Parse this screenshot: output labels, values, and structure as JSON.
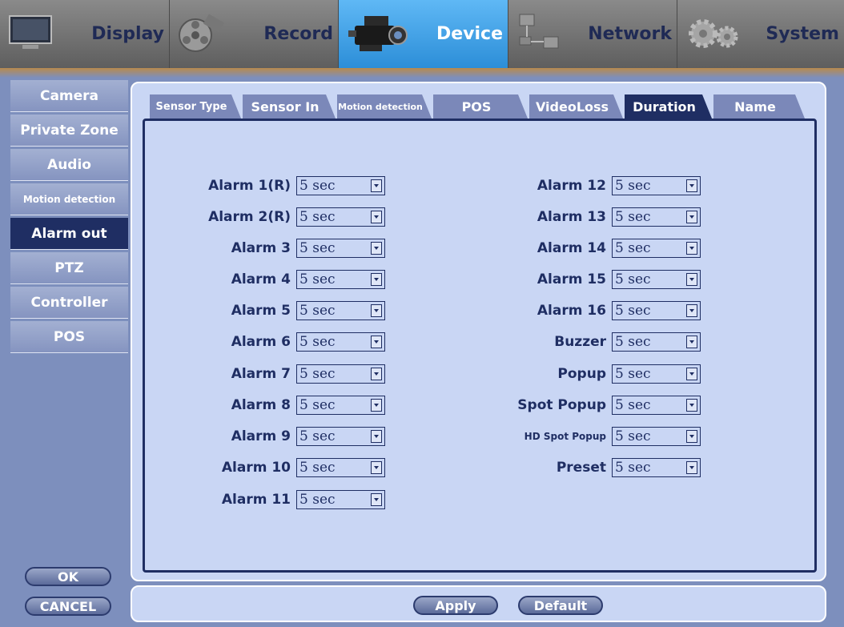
{
  "top_tabs": [
    {
      "label": "Display",
      "icon": "monitor-icon",
      "active": false
    },
    {
      "label": "Record",
      "icon": "film-reel-icon",
      "active": false
    },
    {
      "label": "Device",
      "icon": "video-camera-icon",
      "active": true
    },
    {
      "label": "Network",
      "icon": "network-icon",
      "active": false
    },
    {
      "label": "System",
      "icon": "gears-icon",
      "active": false
    }
  ],
  "sidebar": {
    "items": [
      {
        "label": "Camera"
      },
      {
        "label": "Private Zone"
      },
      {
        "label": "Audio"
      },
      {
        "label": "Motion detection"
      },
      {
        "label": "Alarm out",
        "active": true
      },
      {
        "label": "PTZ"
      },
      {
        "label": "Controller"
      },
      {
        "label": "POS"
      }
    ],
    "ok_label": "OK",
    "cancel_label": "CANCEL"
  },
  "sub_tabs": [
    {
      "label": "Sensor Type"
    },
    {
      "label": "Sensor In"
    },
    {
      "label": "Motion detection"
    },
    {
      "label": "POS"
    },
    {
      "label": "VideoLoss"
    },
    {
      "label": "Duration",
      "active": true
    },
    {
      "label": "Name"
    }
  ],
  "left_alarms": [
    {
      "label": "Alarm 1(R)",
      "value": "5 sec"
    },
    {
      "label": "Alarm 2(R)",
      "value": "5 sec"
    },
    {
      "label": "Alarm 3",
      "value": "5 sec"
    },
    {
      "label": "Alarm 4",
      "value": "5 sec"
    },
    {
      "label": "Alarm 5",
      "value": "5 sec"
    },
    {
      "label": "Alarm 6",
      "value": "5 sec"
    },
    {
      "label": "Alarm 7",
      "value": "5 sec"
    },
    {
      "label": "Alarm 8",
      "value": "5 sec"
    },
    {
      "label": "Alarm 9",
      "value": "5 sec"
    },
    {
      "label": "Alarm 10",
      "value": "5 sec"
    },
    {
      "label": "Alarm 11",
      "value": "5 sec"
    }
  ],
  "right_alarms": [
    {
      "label": "Alarm 12",
      "value": "5 sec"
    },
    {
      "label": "Alarm 13",
      "value": "5 sec"
    },
    {
      "label": "Alarm 14",
      "value": "5 sec"
    },
    {
      "label": "Alarm 15",
      "value": "5 sec"
    },
    {
      "label": "Alarm 16",
      "value": "5 sec"
    },
    {
      "label": "Buzzer",
      "value": "5 sec"
    },
    {
      "label": "Popup",
      "value": "5 sec"
    },
    {
      "label": "Spot Popup",
      "value": "5 sec"
    },
    {
      "label": "HD Spot Popup",
      "value": "5 sec"
    },
    {
      "label": "Preset",
      "value": "5 sec"
    }
  ],
  "buttons": {
    "apply_label": "Apply",
    "default_label": "Default"
  },
  "colors": {
    "active_tab": "#2c8ed8",
    "selected": "#1f2e63",
    "panel": "#c9d6f4",
    "background": "#7d8fbd"
  }
}
